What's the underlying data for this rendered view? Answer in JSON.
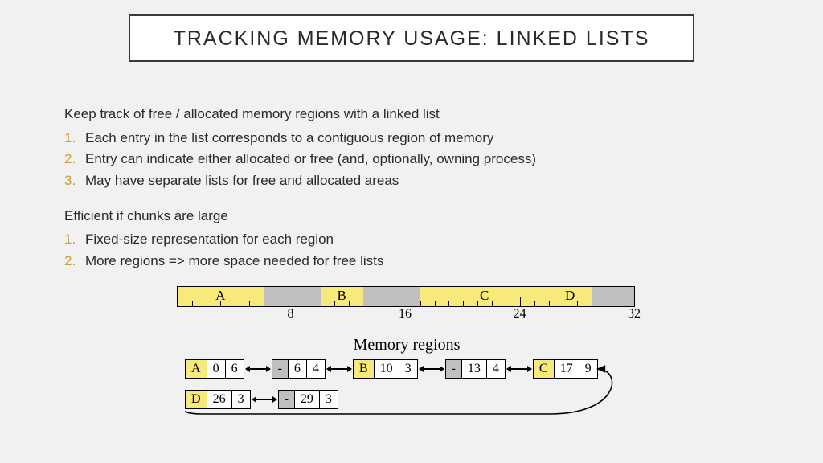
{
  "title": "TRACKING MEMORY USAGE: LINKED LISTS",
  "intro1": "Keep track of free / allocated memory regions with a linked list",
  "list1": [
    "Each entry in the list corresponds to a contiguous region of memory",
    "Entry can indicate either allocated or free (and, optionally, owning process)",
    "May have separate lists for free and allocated areas"
  ],
  "intro2": "Efficient if chunks are large",
  "list2": [
    "Fixed-size representation for each region",
    "More regions => more space needed for free lists"
  ],
  "figure": {
    "caption": "Memory regions",
    "axis": [
      "8",
      "16",
      "24",
      "32"
    ],
    "bar_total": 32,
    "bar_segments": [
      {
        "label": "A",
        "start": 0,
        "len": 6,
        "free": false
      },
      {
        "label": "",
        "start": 6,
        "len": 4,
        "free": true
      },
      {
        "label": "B",
        "start": 10,
        "len": 3,
        "free": false
      },
      {
        "label": "",
        "start": 13,
        "len": 4,
        "free": true
      },
      {
        "label": "C",
        "start": 17,
        "len": 9,
        "free": false
      },
      {
        "label": "D",
        "start": 26,
        "len": 3,
        "free": false
      },
      {
        "label": "",
        "start": 29,
        "len": 3,
        "free": true
      }
    ],
    "nodes_row1": [
      {
        "tag": "A",
        "a": "0",
        "b": "6",
        "free": false
      },
      {
        "tag": "-",
        "a": "6",
        "b": "4",
        "free": true
      },
      {
        "tag": "B",
        "a": "10",
        "b": "3",
        "free": false
      },
      {
        "tag": "-",
        "a": "13",
        "b": "4",
        "free": true
      },
      {
        "tag": "C",
        "a": "17",
        "b": "9",
        "free": false
      }
    ],
    "nodes_row2": [
      {
        "tag": "D",
        "a": "26",
        "b": "3",
        "free": false
      },
      {
        "tag": "-",
        "a": "29",
        "b": "3",
        "free": true
      }
    ]
  }
}
